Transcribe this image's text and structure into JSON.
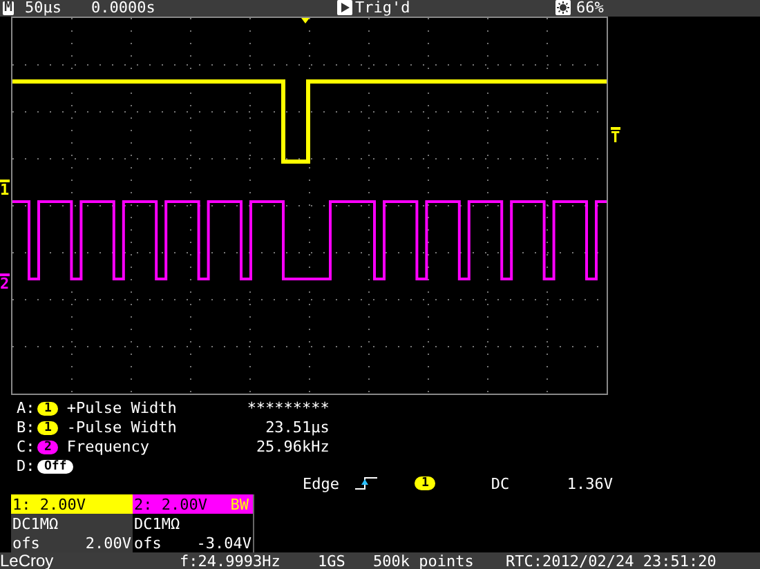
{
  "top_bar": {
    "mode": "M",
    "timebase": "50µs",
    "delay": "0.0000s",
    "trigger_status": "Trig'd",
    "brightness": "66%"
  },
  "markers": [
    {
      "label": "1",
      "color": "#ffff00"
    },
    {
      "label": "2",
      "color": "#ff00ff"
    }
  ],
  "trigger_marker": "T",
  "measurements": [
    {
      "slot": "A:",
      "source": "1",
      "color": "#ffff00",
      "name": "+Pulse Width",
      "value": "*********"
    },
    {
      "slot": "B:",
      "source": "1",
      "color": "#ffff00",
      "name": "-Pulse Width",
      "value": "23.51µs"
    },
    {
      "slot": "C:",
      "source": "2",
      "color": "#ff00ff",
      "name": "Frequency",
      "value": "25.96kHz"
    },
    {
      "slot": "D:",
      "source": "Off",
      "color": "#ffffff"
    }
  ],
  "trigger": {
    "type": "Edge",
    "source": {
      "label": "1",
      "color": "#ffff00"
    },
    "coupling": "DC",
    "level": "1.36V"
  },
  "channels": [
    {
      "header": "1: 2.00V",
      "color": "#ffff00",
      "coupling": "DC1MΩ",
      "offset_label": "ofs",
      "offset": "2.00V"
    },
    {
      "header": "2: 2.00V",
      "bw": "BW",
      "color": "#ff00ff",
      "coupling": "DC1MΩ",
      "offset_label": "ofs",
      "offset": "-3.04V"
    }
  ],
  "status_bar": {
    "brand": "LeCroy",
    "frequency": "f:24.9993Hz",
    "sample_rate": "1GS",
    "memory": "500k points",
    "clock": "RTC:2012/02/24 23:51:20"
  }
}
